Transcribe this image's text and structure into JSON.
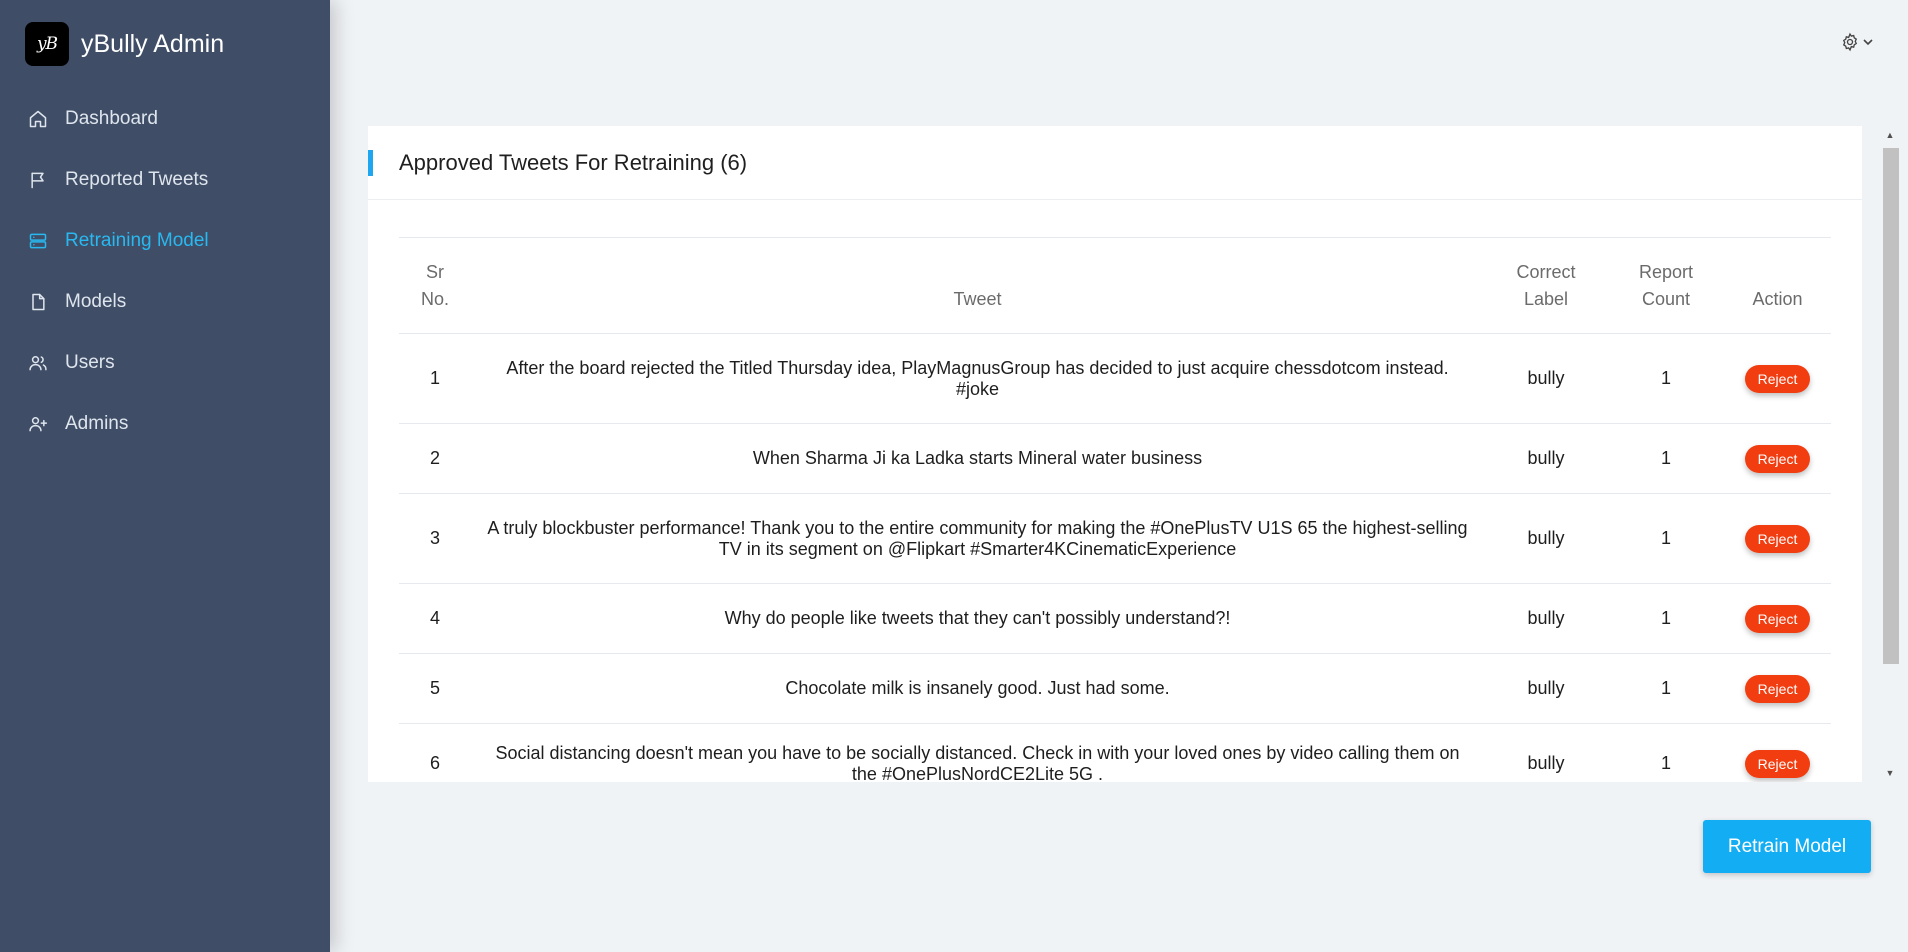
{
  "app": {
    "name": "yBully Admin",
    "logo_text": "yB"
  },
  "sidebar": {
    "items": [
      {
        "label": "Dashboard",
        "icon": "home-icon",
        "active": false
      },
      {
        "label": "Reported Tweets",
        "icon": "flag-icon",
        "active": false
      },
      {
        "label": "Retraining Model",
        "icon": "server-icon",
        "active": true
      },
      {
        "label": "Models",
        "icon": "file-icon",
        "active": false
      },
      {
        "label": "Users",
        "icon": "users-icon",
        "active": false
      },
      {
        "label": "Admins",
        "icon": "user-plus-icon",
        "active": false
      }
    ]
  },
  "topbar": {
    "settings_icon": "gear-icon",
    "dropdown_icon": "chevron-down-icon"
  },
  "card": {
    "title": "Approved Tweets For Retraining (6)"
  },
  "table": {
    "headers": {
      "sr_line1": "Sr",
      "sr_line2": "No.",
      "tweet": "Tweet",
      "label_line1": "Correct",
      "label_line2": "Label",
      "count_line1": "Report",
      "count_line2": "Count",
      "action": "Action"
    },
    "rows": [
      {
        "sr": "1",
        "tweet": "After the board rejected the Titled Thursday idea, PlayMagnusGroup has decided to just acquire chessdotcom instead. #joke",
        "label": "bully",
        "count": "1",
        "action": "Reject"
      },
      {
        "sr": "2",
        "tweet": "When Sharma Ji ka Ladka starts Mineral water business",
        "label": "bully",
        "count": "1",
        "action": "Reject"
      },
      {
        "sr": "3",
        "tweet": "A truly blockbuster performance! Thank you to the entire community for making the #OnePlusTV U1S 65 the highest-selling TV in its segment on @Flipkart #Smarter4KCinematicExperience",
        "label": "bully",
        "count": "1",
        "action": "Reject"
      },
      {
        "sr": "4",
        "tweet": "Why do people like tweets that they can't possibly understand?!",
        "label": "bully",
        "count": "1",
        "action": "Reject"
      },
      {
        "sr": "5",
        "tweet": "Chocolate milk is insanely good. Just had some.",
        "label": "bully",
        "count": "1",
        "action": "Reject"
      },
      {
        "sr": "6",
        "tweet": "Social distancing doesn't mean you have to be socially distanced. Check in with your loved ones by video calling them on the #OnePlusNordCE2Lite 5G .",
        "label": "bully",
        "count": "1",
        "action": "Reject"
      }
    ]
  },
  "footer": {
    "retrain_label": "Retrain Model"
  },
  "colors": {
    "sidebar_bg": "#3f4e66",
    "active_accent": "#29b8f0",
    "reject": "#f23d11",
    "primary": "#13adf3"
  }
}
